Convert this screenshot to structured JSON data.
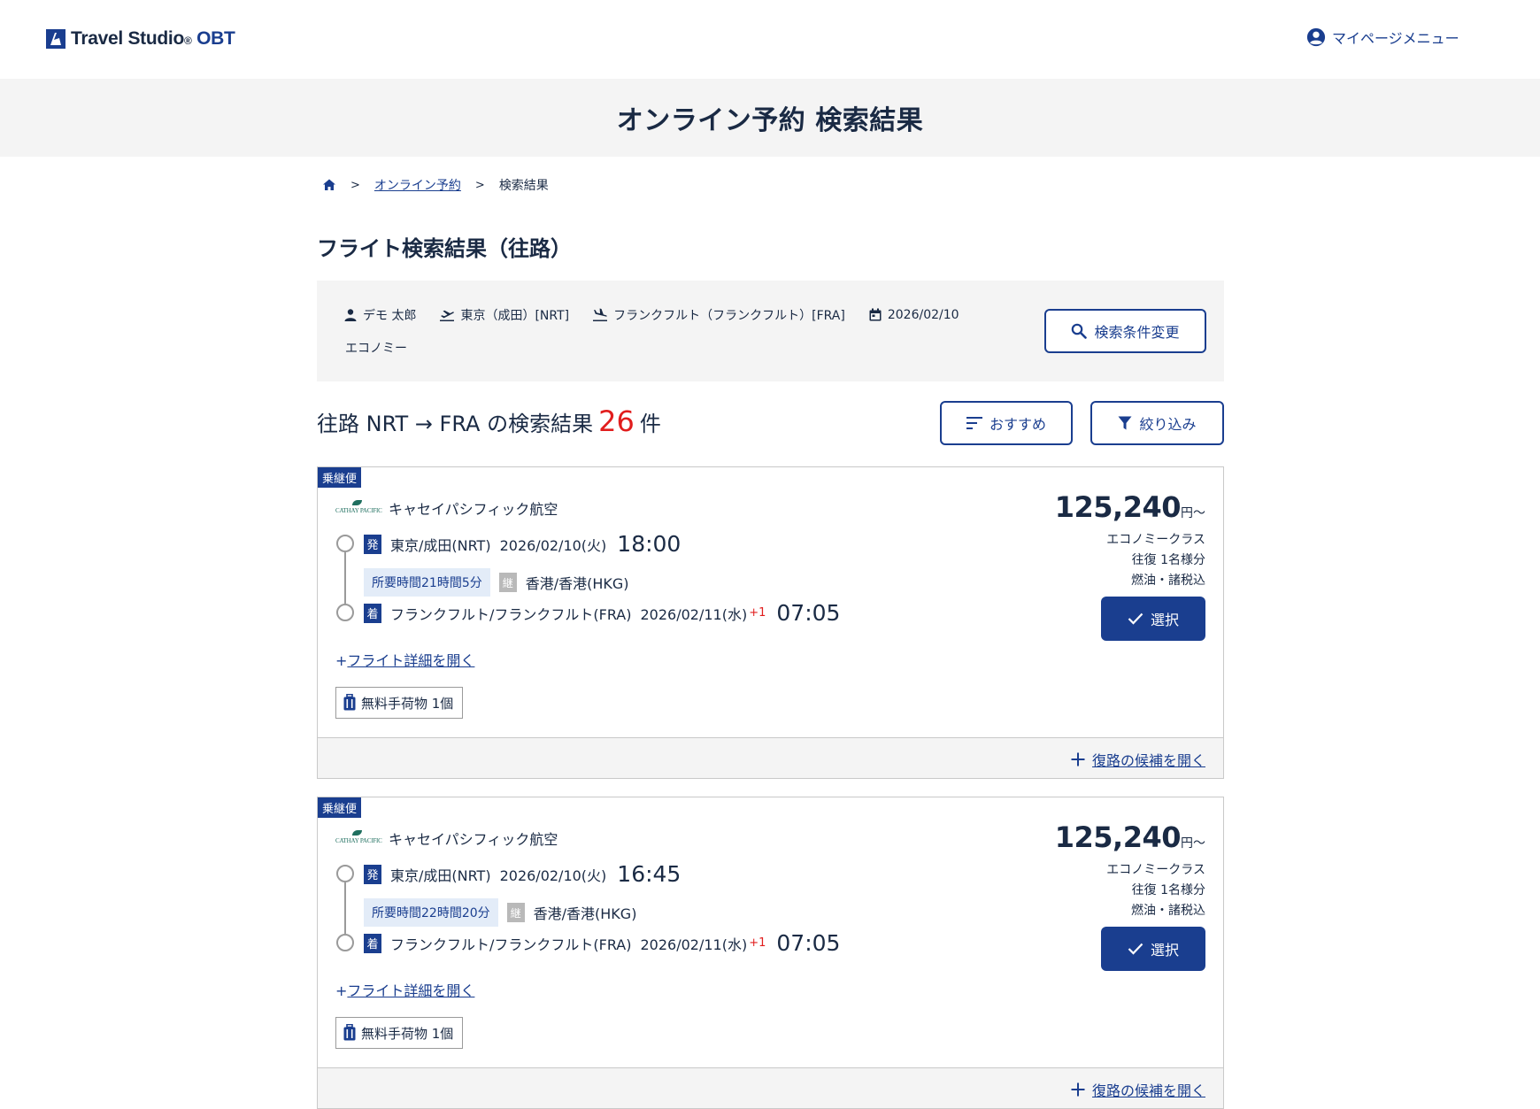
{
  "header": {
    "logo_text": "Travel Studio",
    "logo_suffix": "OBT",
    "mypage_label": "マイページメニュー"
  },
  "hero": {
    "title": "オンライン予約 検索結果"
  },
  "breadcrumb": {
    "link": "オンライン予約",
    "current": "検索結果",
    "sep": ">"
  },
  "section_title": "フライト検索結果（往路）",
  "conditions": {
    "traveler": "デモ 太郎",
    "departure": "東京（成田）[NRT]",
    "arrival": "フランクフルト（フランクフルト）[FRA]",
    "date": "2026/02/10",
    "cabin": "エコノミー",
    "change_button": "検索条件変更"
  },
  "results": {
    "prefix": "往路 NRT → FRA の検索結果",
    "count": "26",
    "suffix": "件",
    "sort_button": "おすすめ",
    "filter_button": "絞り込み"
  },
  "colors": {
    "brand": "#1a3e8f",
    "accent_red": "#e11d1d",
    "panel_gray": "#f4f4f4"
  },
  "flights": [
    {
      "badge": "乗継便",
      "airline": "キャセイパシフィック航空",
      "airline_logo_text": "CATHAY PACIFIC",
      "dep_tag": "発",
      "dep_place": "東京/成田(NRT)",
      "dep_date": "2026/02/10(火)",
      "dep_time": "18:00",
      "duration": "所要時間21時間5分",
      "via_tag": "継",
      "via_place": "香港/香港(HKG)",
      "arr_tag": "着",
      "arr_place": "フランクフルト/フランクフルト(FRA)",
      "arr_date": "2026/02/11(水)",
      "arr_day_offset": "+1",
      "arr_time": "07:05",
      "detail_link": "フライト詳細を開く",
      "baggage": "無料手荷物 1個",
      "price": "125,240",
      "price_unit": "円～",
      "price_class": "エコノミークラス",
      "price_pax": "往復 1名様分",
      "price_tax": "燃油・諸税込",
      "select_button": "選択",
      "return_link": "復路の候補を開く"
    },
    {
      "badge": "乗継便",
      "airline": "キャセイパシフィック航空",
      "airline_logo_text": "CATHAY PACIFIC",
      "dep_tag": "発",
      "dep_place": "東京/成田(NRT)",
      "dep_date": "2026/02/10(火)",
      "dep_time": "16:45",
      "duration": "所要時間22時間20分",
      "via_tag": "継",
      "via_place": "香港/香港(HKG)",
      "arr_tag": "着",
      "arr_place": "フランクフルト/フランクフルト(FRA)",
      "arr_date": "2026/02/11(水)",
      "arr_day_offset": "+1",
      "arr_time": "07:05",
      "detail_link": "フライト詳細を開く",
      "baggage": "無料手荷物 1個",
      "price": "125,240",
      "price_unit": "円～",
      "price_class": "エコノミークラス",
      "price_pax": "往復 1名様分",
      "price_tax": "燃油・諸税込",
      "select_button": "選択",
      "return_link": "復路の候補を開く"
    }
  ]
}
